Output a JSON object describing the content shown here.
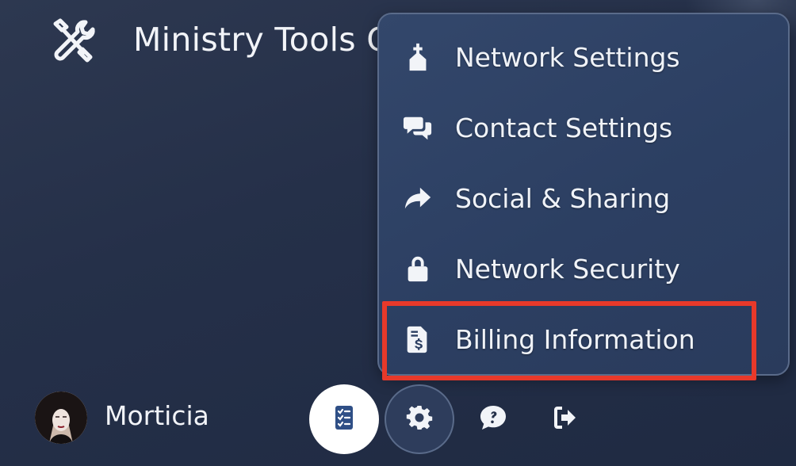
{
  "app": {
    "title": "Ministry Tools C",
    "logo_icon": "tools-wrench-screwdriver-icon"
  },
  "settings_menu": {
    "items": [
      {
        "label": "Network Settings",
        "icon": "church-icon"
      },
      {
        "label": "Contact Settings",
        "icon": "comments-icon"
      },
      {
        "label": "Social & Sharing",
        "icon": "share-arrow-icon"
      },
      {
        "label": "Network Security",
        "icon": "lock-icon"
      },
      {
        "label": "Billing Information",
        "icon": "invoice-dollar-icon"
      }
    ],
    "highlighted_item": "Billing Information",
    "highlight_color": "#e8392a"
  },
  "footer": {
    "user": {
      "name": "Morticia",
      "avatar": "user-avatar"
    },
    "buttons": [
      {
        "icon": "tasks-list-icon",
        "active_bg": "#ffffff",
        "icon_color": "#2f4f86"
      },
      {
        "icon": "gear-icon",
        "state": "open"
      },
      {
        "icon": "question-comment-icon"
      },
      {
        "icon": "sign-out-icon"
      }
    ]
  },
  "colors": {
    "background": "#253049",
    "menu_background": "#2f4266",
    "text": "#f2f4f8"
  }
}
